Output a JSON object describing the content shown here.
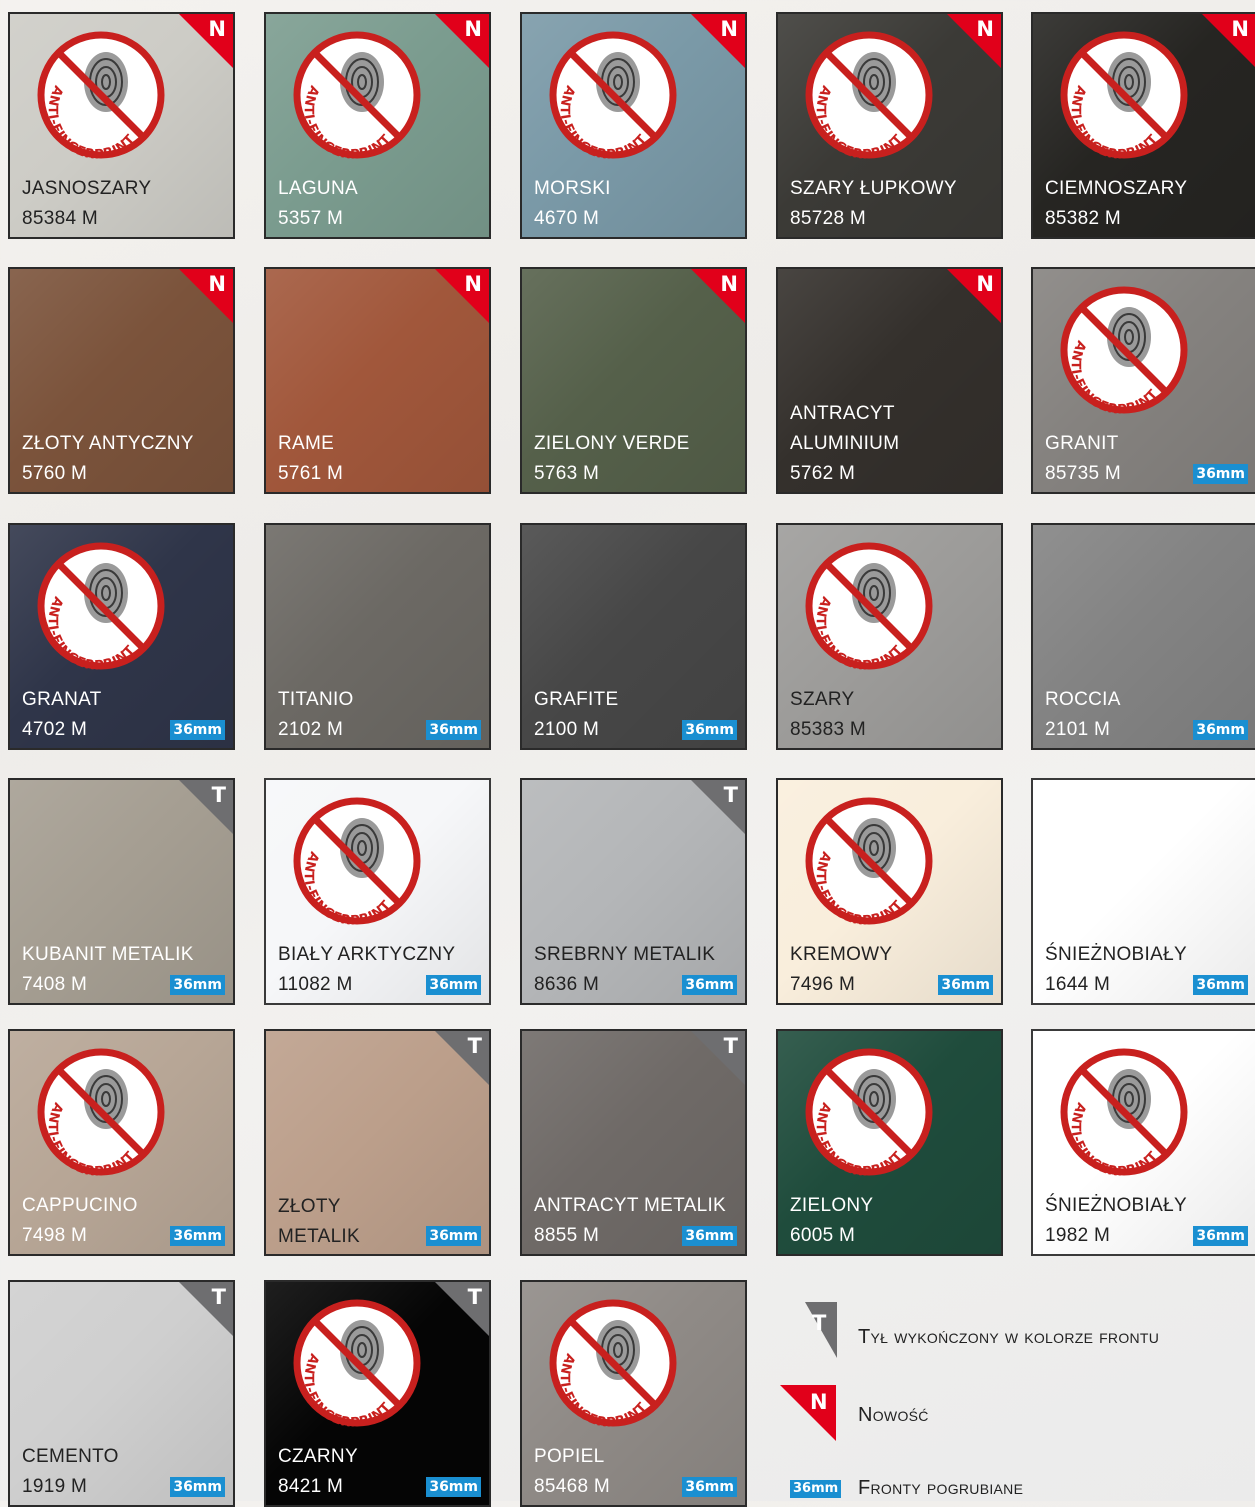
{
  "badges": {
    "new_letter": "N",
    "back_letter": "T",
    "thick": "36mm",
    "anti_fingerprint": "ANTI-FINGERPRINT"
  },
  "legend": {
    "back_letter": "T",
    "back_text": "Tył wykończony w kolorze frontu",
    "new_letter": "N",
    "new_text": "Nowość",
    "thick_badge": "36mm",
    "thick_text": "Fronty pogrubiane"
  },
  "colors": {
    "new_corner": "#e1001a",
    "back_corner": "#6e6e70",
    "thick_badge": "#1a8fd1"
  },
  "swatches": [
    {
      "name": "JASNOSZARY",
      "code": "85384 M",
      "color": "#cdccc6",
      "text_color": "#222222",
      "new": true,
      "back": false,
      "thick": false,
      "af": true
    },
    {
      "name": "LAGUNA",
      "code": "5357 M",
      "color": "#7b9c8f",
      "text_color": "#ffffff",
      "new": true,
      "back": false,
      "thick": false,
      "af": true
    },
    {
      "name": "MORSKI",
      "code": "4670 M",
      "color": "#7a99a7",
      "text_color": "#ffffff",
      "new": true,
      "back": false,
      "thick": false,
      "af": true
    },
    {
      "name": "SZARY ŁUPKOWY",
      "code": "85728 M",
      "color": "#3b3a36",
      "text_color": "#ffffff",
      "new": true,
      "back": false,
      "thick": false,
      "af": true
    },
    {
      "name": "CIEMNOSZARY",
      "code": "85382 M",
      "color": "#262522",
      "text_color": "#ffffff",
      "new": true,
      "back": false,
      "thick": false,
      "af": true
    },
    {
      "name": "ZŁOTY ANTYCZNY",
      "code": "5760 M",
      "color": "#7b533b",
      "text_color": "#ffffff",
      "new": true,
      "back": false,
      "thick": false,
      "af": false
    },
    {
      "name": "RAME",
      "code": "5761 M",
      "color": "#a1573b",
      "text_color": "#ffffff",
      "new": true,
      "back": false,
      "thick": false,
      "af": false
    },
    {
      "name": "ZIELONY VERDE",
      "code": "5763 M",
      "color": "#55604a",
      "text_color": "#ffffff",
      "new": true,
      "back": false,
      "thick": false,
      "af": false
    },
    {
      "name": "ANTRACYT",
      "name2": "ALUMINIUM",
      "code": "5762 M",
      "color": "#34302c",
      "text_color": "#ffffff",
      "new": true,
      "back": false,
      "thick": false,
      "af": false
    },
    {
      "name": "GRANIT",
      "code": "85735 M",
      "color": "#85827f",
      "text_color": "#ffffff",
      "new": false,
      "back": false,
      "thick": true,
      "af": true
    },
    {
      "name": "GRANAT",
      "code": "4702 M",
      "color": "#2f3549",
      "text_color": "#ffffff",
      "new": false,
      "back": false,
      "thick": true,
      "af": true
    },
    {
      "name": "TITANIO",
      "code": "2102 M",
      "color": "#6c6964",
      "text_color": "#ffffff",
      "new": false,
      "back": false,
      "thick": true,
      "af": false
    },
    {
      "name": "GRAFITE",
      "code": "2100 M",
      "color": "#474747",
      "text_color": "#ffffff",
      "new": false,
      "back": false,
      "thick": true,
      "af": false
    },
    {
      "name": "SZARY",
      "code": "85383 M",
      "color": "#9d9c9a",
      "text_color": "#222222",
      "new": false,
      "back": false,
      "thick": false,
      "af": true
    },
    {
      "name": "ROCCIA",
      "code": "2101 M",
      "color": "#838383",
      "text_color": "#ffffff",
      "new": false,
      "back": false,
      "thick": true,
      "af": false
    },
    {
      "name": "KUBANIT METALIK",
      "code": "7408 M",
      "color": "#a59e92",
      "text_color": "#ffffff",
      "new": false,
      "back": true,
      "thick": true,
      "af": false
    },
    {
      "name": "BIAŁY ARKTYCZNY",
      "code": "11082 M",
      "color": "#f6f7f9",
      "text_color": "#222222",
      "new": false,
      "back": false,
      "thick": true,
      "af": true
    },
    {
      "name": "SREBRNY METALIK",
      "code": "8636 M",
      "color": "#b4b6b8",
      "text_color": "#222222",
      "new": false,
      "back": true,
      "thick": true,
      "af": false
    },
    {
      "name": "KREMOWY",
      "code": "7496 M",
      "color": "#f9eedc",
      "text_color": "#222222",
      "new": false,
      "back": false,
      "thick": true,
      "af": true
    },
    {
      "name": "ŚNIEŻNOBIAŁY",
      "code": "1644 M",
      "color": "#ffffff",
      "text_color": "#222222",
      "new": false,
      "back": false,
      "thick": true,
      "af": false
    },
    {
      "name": "CAPPUCINO",
      "code": "7498 M",
      "color": "#b7a696",
      "text_color": "#ffffff",
      "new": false,
      "back": false,
      "thick": true,
      "af": true
    },
    {
      "name": "ZŁOTY",
      "name2": "METALIK",
      "code": "",
      "color": "#bc9f8b",
      "text_color": "#222222",
      "new": false,
      "back": true,
      "thick": true,
      "af": false
    },
    {
      "name": "ANTRACYT METALIK",
      "code": "8855 M",
      "color": "#6f6a67",
      "text_color": "#ffffff",
      "new": false,
      "back": true,
      "thick": true,
      "af": false
    },
    {
      "name": "ZIELONY",
      "code": "6005 M",
      "color": "#1f4c3c",
      "text_color": "#ffffff",
      "new": false,
      "back": false,
      "thick": false,
      "af": true
    },
    {
      "name": "ŚNIEŻNOBIAŁY",
      "code": "1982 M",
      "color": "#ffffff",
      "text_color": "#222222",
      "new": false,
      "back": false,
      "thick": true,
      "af": true
    },
    {
      "name": "CEMENTO",
      "code": "1919 M",
      "color": "#cfcfcf",
      "text_color": "#222222",
      "new": false,
      "back": true,
      "thick": true,
      "af": false
    },
    {
      "name": "CZARNY",
      "code": "8421 M",
      "color": "#050505",
      "text_color": "#ffffff",
      "new": false,
      "back": true,
      "thick": true,
      "af": true
    },
    {
      "name": "POPIEL",
      "code": "85468 M",
      "color": "#8f8a86",
      "text_color": "#ffffff",
      "new": false,
      "back": false,
      "thick": true,
      "af": true
    }
  ]
}
